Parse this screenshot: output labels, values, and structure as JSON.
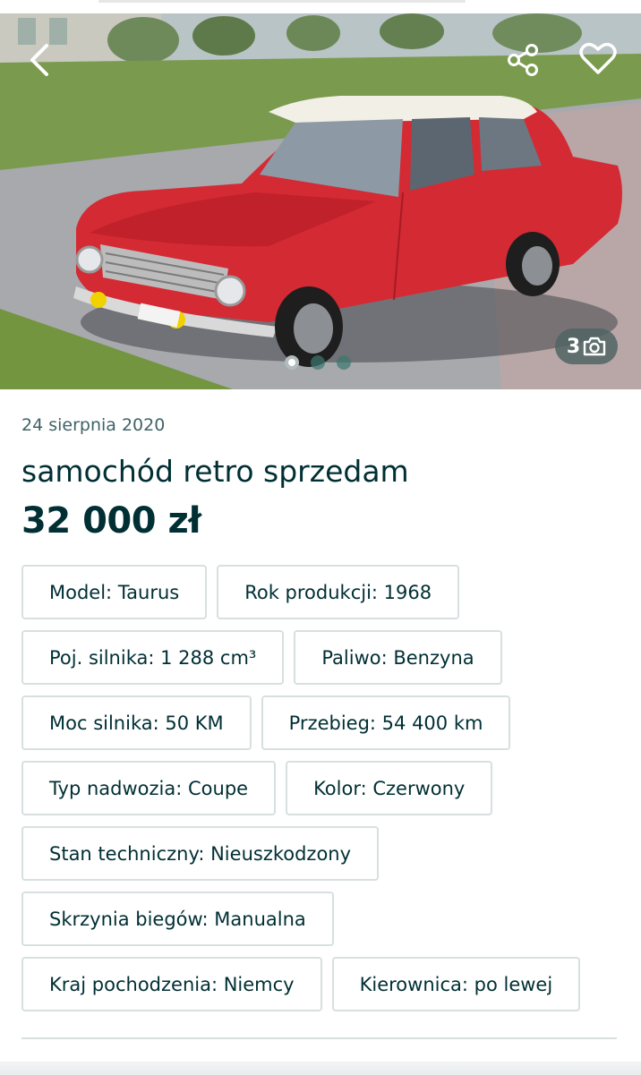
{
  "gallery": {
    "photo_count": "3",
    "back_icon": "chevron-left-icon",
    "share_icon": "share-icon",
    "favorite_icon": "heart-outline-icon",
    "camera_icon": "camera-icon",
    "current_slide": 1,
    "total_slides": 3,
    "photo_subject": "red classic two-door coupe with white roof"
  },
  "listing": {
    "date": "24 sierpnia 2020",
    "title": "samochód retro sprzedam",
    "price": "32 000 zł"
  },
  "params": [
    {
      "label": "Model: Taurus"
    },
    {
      "label": "Rok produkcji: 1968"
    },
    {
      "label": "Poj. silnika: 1 288 cm³"
    },
    {
      "label": "Paliwo: Benzyna"
    },
    {
      "label": "Moc silnika: 50 KM"
    },
    {
      "label": "Przebieg: 54 400 km"
    },
    {
      "label": "Typ nadwozia: Coupe"
    },
    {
      "label": "Kolor: Czerwony"
    },
    {
      "label": "Stan techniczny: Nieuszkodzony"
    },
    {
      "label": "Skrzynia biegów: Manualna"
    },
    {
      "label": "Kraj pochodzenia: Niemcy"
    },
    {
      "label": "Kierownica: po lewej"
    }
  ],
  "colors": {
    "text_primary": "#002f34",
    "chip_border": "#d8dfe0",
    "car_red": "#d42a34"
  }
}
